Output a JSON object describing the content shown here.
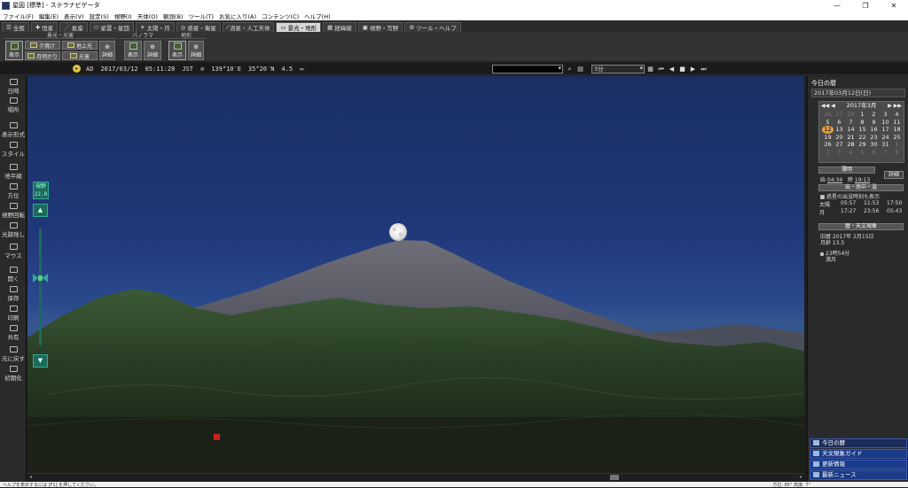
{
  "window": {
    "title": "星図 [標準] - ステラナビゲータ",
    "controls": [
      "—",
      "❐",
      "✕"
    ]
  },
  "menu": [
    "ファイル(F)",
    "編集(E)",
    "表示(V)",
    "設定(S)",
    "視野(I)",
    "天体(O)",
    "観測(B)",
    "ツール(T)",
    "お気に入り(A)",
    "コンテンツ(C)",
    "ヘルプ(H)"
  ],
  "tabs": [
    "全般",
    "恒星",
    "星座",
    "星雲・星団",
    "太陽・月",
    "惑星・衛星",
    "流星・人工天体",
    "景光・地形",
    "経緯線",
    "視野・写野",
    "ツール・ヘルプ"
  ],
  "active_tab": "景光・地形",
  "ribbon": {
    "group1": {
      "label": "景光・光害",
      "display": "表示",
      "twilight": "夕焼け",
      "moonlight": "月明かり",
      "horizon_light": "地上光",
      "light_pollution": "光害",
      "detail": "詳細"
    },
    "group2": {
      "label": "パノラマ",
      "display": "表示",
      "detail": "詳細"
    },
    "group3": {
      "label": "地形",
      "display": "表示",
      "detail": "詳細"
    }
  },
  "infobar": {
    "era": "AD",
    "date": "2017/03/12",
    "time": "05:11:28",
    "timezone": "JST",
    "longitude": "139°10′E",
    "latitude": "35°20′N",
    "magnitude": "4.5",
    "step": "3分",
    "controls": [
      "⏮",
      "◀",
      "■",
      "▶",
      "⏭"
    ]
  },
  "left_toolbar": [
    "日時",
    "場所",
    "表示形式",
    "スタイル",
    "地平線",
    "方位",
    "視野回転",
    "光跡残し",
    "マウス",
    "開く",
    "保存",
    "印刷",
    "共有",
    "元に戻す",
    "初期化"
  ],
  "fov": {
    "label": "視野",
    "value": "22.0"
  },
  "right_panel": {
    "title": "今日の暦",
    "date": "2017年03月12日(日)",
    "calendar": {
      "month": "2017年3月",
      "nav_prev": "◀◀ ◀",
      "nav_next": "▶ ▶▶",
      "rows": [
        [
          "26",
          "27",
          "28",
          "1",
          "2",
          "3",
          "4"
        ],
        [
          "5",
          "6",
          "7",
          "8",
          "9",
          "10",
          "11"
        ],
        [
          "12",
          "13",
          "14",
          "15",
          "16",
          "17",
          "18"
        ],
        [
          "19",
          "20",
          "21",
          "22",
          "23",
          "24",
          "25"
        ],
        [
          "26",
          "27",
          "28",
          "29",
          "30",
          "31",
          "1"
        ],
        [
          "2",
          "3",
          "4",
          "5",
          "6",
          "7",
          "8"
        ]
      ],
      "today": "12"
    },
    "twilight": {
      "label": "薄明",
      "dawn_label": "始",
      "dawn": "04:34",
      "dusk_label": "終",
      "dusk": "19:13",
      "detail": "詳細"
    },
    "rise_set": {
      "label": "出・南中・没",
      "check_label": "惑星の出没時刻も表示",
      "rows": [
        {
          "name": "太陽",
          "rise": "05:57",
          "transit": "11:53",
          "set": "17:50"
        },
        {
          "name": "月",
          "rise": "17:27",
          "transit": "23:56",
          "set": "05:43"
        }
      ]
    },
    "calendar_info": {
      "label": "暦・天文現象",
      "lunar": "旧暦 2017年 2月15日",
      "moon_age": "月齢 13.5",
      "event_time": "23時54分",
      "event": "満月"
    }
  },
  "news": [
    "今日の暦",
    "天文現象ガイド",
    "更新情報",
    "最新ニュース"
  ],
  "statusbar": {
    "hint": "ヘルプを表示するには [F1] を押してください。",
    "right": "方位: 85°  高度: 7°"
  }
}
